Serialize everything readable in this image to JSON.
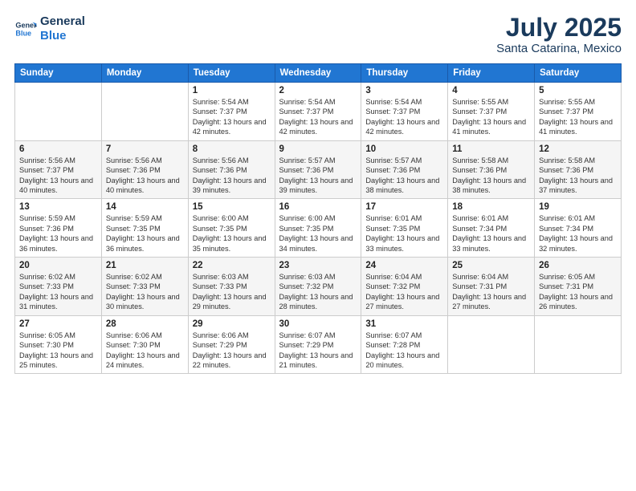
{
  "header": {
    "logo_line1": "General",
    "logo_line2": "Blue",
    "month": "July 2025",
    "location": "Santa Catarina, Mexico"
  },
  "weekdays": [
    "Sunday",
    "Monday",
    "Tuesday",
    "Wednesday",
    "Thursday",
    "Friday",
    "Saturday"
  ],
  "weeks": [
    [
      {
        "day": "",
        "info": ""
      },
      {
        "day": "",
        "info": ""
      },
      {
        "day": "1",
        "info": "Sunrise: 5:54 AM\nSunset: 7:37 PM\nDaylight: 13 hours and 42 minutes."
      },
      {
        "day": "2",
        "info": "Sunrise: 5:54 AM\nSunset: 7:37 PM\nDaylight: 13 hours and 42 minutes."
      },
      {
        "day": "3",
        "info": "Sunrise: 5:54 AM\nSunset: 7:37 PM\nDaylight: 13 hours and 42 minutes."
      },
      {
        "day": "4",
        "info": "Sunrise: 5:55 AM\nSunset: 7:37 PM\nDaylight: 13 hours and 41 minutes."
      },
      {
        "day": "5",
        "info": "Sunrise: 5:55 AM\nSunset: 7:37 PM\nDaylight: 13 hours and 41 minutes."
      }
    ],
    [
      {
        "day": "6",
        "info": "Sunrise: 5:56 AM\nSunset: 7:37 PM\nDaylight: 13 hours and 40 minutes."
      },
      {
        "day": "7",
        "info": "Sunrise: 5:56 AM\nSunset: 7:36 PM\nDaylight: 13 hours and 40 minutes."
      },
      {
        "day": "8",
        "info": "Sunrise: 5:56 AM\nSunset: 7:36 PM\nDaylight: 13 hours and 39 minutes."
      },
      {
        "day": "9",
        "info": "Sunrise: 5:57 AM\nSunset: 7:36 PM\nDaylight: 13 hours and 39 minutes."
      },
      {
        "day": "10",
        "info": "Sunrise: 5:57 AM\nSunset: 7:36 PM\nDaylight: 13 hours and 38 minutes."
      },
      {
        "day": "11",
        "info": "Sunrise: 5:58 AM\nSunset: 7:36 PM\nDaylight: 13 hours and 38 minutes."
      },
      {
        "day": "12",
        "info": "Sunrise: 5:58 AM\nSunset: 7:36 PM\nDaylight: 13 hours and 37 minutes."
      }
    ],
    [
      {
        "day": "13",
        "info": "Sunrise: 5:59 AM\nSunset: 7:36 PM\nDaylight: 13 hours and 36 minutes."
      },
      {
        "day": "14",
        "info": "Sunrise: 5:59 AM\nSunset: 7:35 PM\nDaylight: 13 hours and 36 minutes."
      },
      {
        "day": "15",
        "info": "Sunrise: 6:00 AM\nSunset: 7:35 PM\nDaylight: 13 hours and 35 minutes."
      },
      {
        "day": "16",
        "info": "Sunrise: 6:00 AM\nSunset: 7:35 PM\nDaylight: 13 hours and 34 minutes."
      },
      {
        "day": "17",
        "info": "Sunrise: 6:01 AM\nSunset: 7:35 PM\nDaylight: 13 hours and 33 minutes."
      },
      {
        "day": "18",
        "info": "Sunrise: 6:01 AM\nSunset: 7:34 PM\nDaylight: 13 hours and 33 minutes."
      },
      {
        "day": "19",
        "info": "Sunrise: 6:01 AM\nSunset: 7:34 PM\nDaylight: 13 hours and 32 minutes."
      }
    ],
    [
      {
        "day": "20",
        "info": "Sunrise: 6:02 AM\nSunset: 7:33 PM\nDaylight: 13 hours and 31 minutes."
      },
      {
        "day": "21",
        "info": "Sunrise: 6:02 AM\nSunset: 7:33 PM\nDaylight: 13 hours and 30 minutes."
      },
      {
        "day": "22",
        "info": "Sunrise: 6:03 AM\nSunset: 7:33 PM\nDaylight: 13 hours and 29 minutes."
      },
      {
        "day": "23",
        "info": "Sunrise: 6:03 AM\nSunset: 7:32 PM\nDaylight: 13 hours and 28 minutes."
      },
      {
        "day": "24",
        "info": "Sunrise: 6:04 AM\nSunset: 7:32 PM\nDaylight: 13 hours and 27 minutes."
      },
      {
        "day": "25",
        "info": "Sunrise: 6:04 AM\nSunset: 7:31 PM\nDaylight: 13 hours and 27 minutes."
      },
      {
        "day": "26",
        "info": "Sunrise: 6:05 AM\nSunset: 7:31 PM\nDaylight: 13 hours and 26 minutes."
      }
    ],
    [
      {
        "day": "27",
        "info": "Sunrise: 6:05 AM\nSunset: 7:30 PM\nDaylight: 13 hours and 25 minutes."
      },
      {
        "day": "28",
        "info": "Sunrise: 6:06 AM\nSunset: 7:30 PM\nDaylight: 13 hours and 24 minutes."
      },
      {
        "day": "29",
        "info": "Sunrise: 6:06 AM\nSunset: 7:29 PM\nDaylight: 13 hours and 22 minutes."
      },
      {
        "day": "30",
        "info": "Sunrise: 6:07 AM\nSunset: 7:29 PM\nDaylight: 13 hours and 21 minutes."
      },
      {
        "day": "31",
        "info": "Sunrise: 6:07 AM\nSunset: 7:28 PM\nDaylight: 13 hours and 20 minutes."
      },
      {
        "day": "",
        "info": ""
      },
      {
        "day": "",
        "info": ""
      }
    ]
  ]
}
